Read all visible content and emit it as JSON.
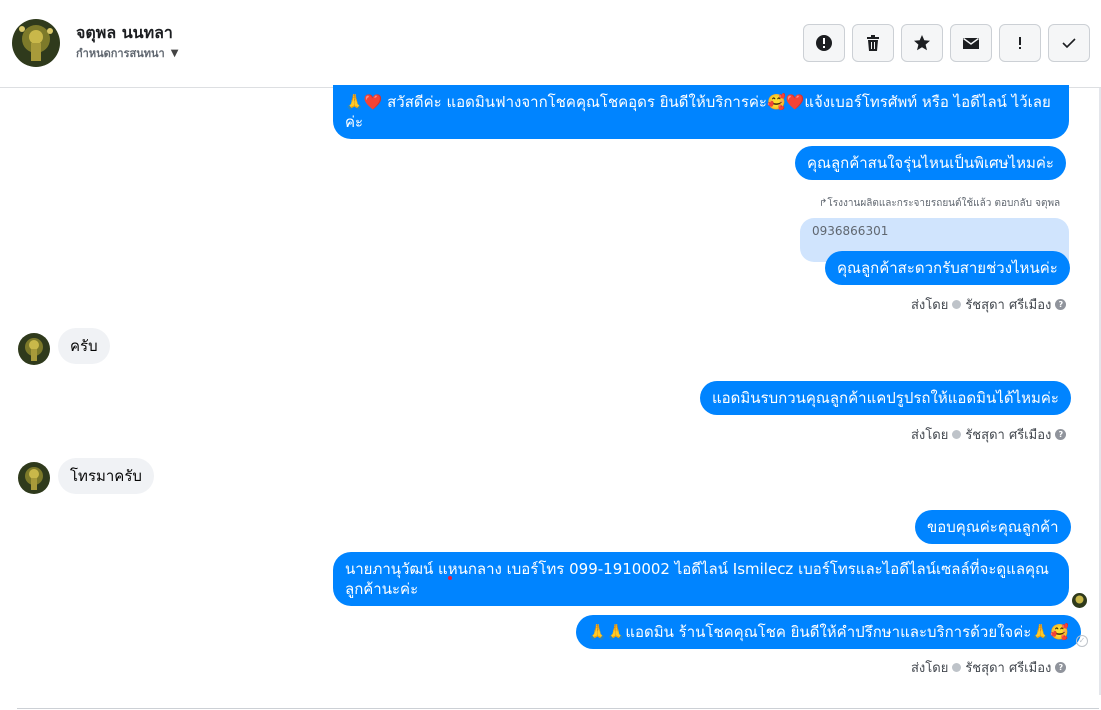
{
  "header": {
    "name": "จตุพล นนทลา",
    "subtitle": "กำหนดการสนทนา",
    "actions": [
      {
        "name": "report-button",
        "icon": "exclamation-circle-icon"
      },
      {
        "name": "delete-button",
        "icon": "trash-icon"
      },
      {
        "name": "star-button",
        "icon": "star-icon"
      },
      {
        "name": "mark-unread-button",
        "icon": "envelope-icon"
      },
      {
        "name": "follow-up-button",
        "icon": "exclamation-icon"
      },
      {
        "name": "mark-done-button",
        "icon": "checkmark-icon"
      }
    ]
  },
  "messages": {
    "m1": "🙏❤️ สวัสดีค่ะ แอดมินฟางจากโชคคุณโชคอุดร ยินดีให้บริการค่ะ🥰❤️แจ้งเบอร์โทรศัพท์ หรือ ไอดีไลน์  ไว้เลยค่ะ",
    "m2": "คุณลูกค้าสนใจรุ่นไหนเป็นพิเศษไหมค่ะ",
    "reply_note": "↱โรงงานผลิตและกระจายรถยนต์ใช้แล้ว ตอบกลับ จตุพล",
    "quoted": "0936866301",
    "m3": "คุณลูกค้าสะดวกรับสายช่วงไหนค่ะ",
    "in1": "ครับ",
    "m4": "แอดมินรบกวนคุณลูกค้าแคปรูปรถให้แอดมินได้ไหมค่ะ",
    "in2": "โทรมาครับ",
    "m5": "ขอบคุณค่ะคุณลูกค้า",
    "m6": "นายภานุวัฒน์ แหนกลาง เบอร์โทร 099-1910002 ไอดีไลน์ Ismilecz   เบอร์โทรและไอดีไลน์เซลล์ที่จะดูแลคุณลูกค้านะค่ะ",
    "m7": "🙏🙏แอดมิน ร้านโชคคุณโชค ยินดีให้คำปรึกษาและบริการด้วยใจค่ะ🙏🥰"
  },
  "sent_by": {
    "prefix": "ส่งโดย",
    "sender": "รัชสุดา ศรีเมือง",
    "help": "?"
  }
}
